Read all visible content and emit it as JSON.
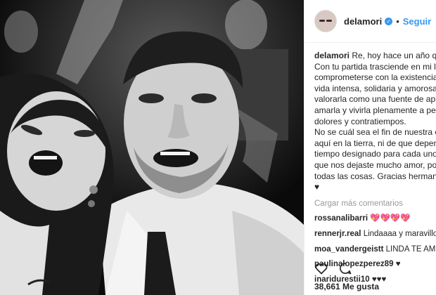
{
  "post": {
    "username": "delamori",
    "follow_label": "Seguir",
    "separator": "•",
    "caption_lines": [
      "Re, hoy hace un año que",
      "Con tu partida trasciende en mi la i",
      "comprometerse con la existencia, v",
      "vida intensa, solidaria y amorosam",
      "valorarla como una fuente de apren",
      "amarla y vivirla plenamente a pesar",
      "dolores y contratiempos.",
      "No se cuál sea el fin de nuestra est",
      "aquí en la tierra, ni de que dependa",
      "tiempo designado para cada uno, s",
      "que nos dejaste mucho amor, por s",
      "todas las cosas. Gracias hermanito",
      "♥"
    ],
    "load_more_label": "Cargar más comentarios",
    "comments": [
      {
        "user": "rossanalibarri",
        "text": "💖💖💖💖"
      },
      {
        "user": "rennerjr.real",
        "text": "Lindaaaa y maravillosa"
      },
      {
        "user": "moa_vandergeistt",
        "text": "LINDA TE AMO 💖"
      },
      {
        "user": "paulinalopezperez89",
        "text": "♥"
      },
      {
        "user": "inaridurestii10",
        "text": "♥♥♥"
      }
    ],
    "likes_text": "38,661 Me gusta",
    "icons": {
      "verified": "verified-badge-icon",
      "like": "heart-icon",
      "comment": "comment-bubble-icon"
    },
    "colors": {
      "link": "#3897f0",
      "muted": "#999999",
      "text": "#262626"
    }
  }
}
